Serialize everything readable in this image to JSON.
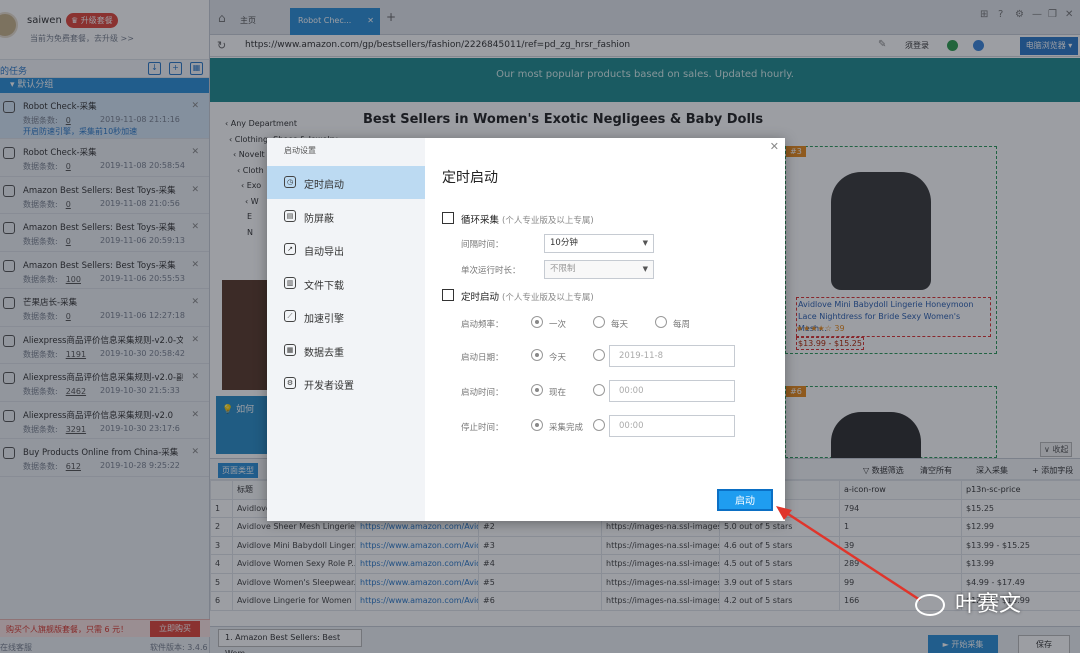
{
  "user": {
    "name": "saiwen",
    "upgrade_badge": "♛ 升级套餐",
    "free_hint": "当前为免费套餐，去升级 >>"
  },
  "task_toolbar": {
    "label": "的任务"
  },
  "group": {
    "name": "默认分组"
  },
  "tasks": [
    {
      "title": "Robot Check-采集",
      "count_label": "数据条数:",
      "count": "0",
      "time": "2019-11-08 21:1:16",
      "alert": "开启防速引擎，采集前10秒加速"
    },
    {
      "title": "Robot Check-采集",
      "count_label": "数据条数:",
      "count": "0",
      "time": "2019-11-08 20:58:54"
    },
    {
      "title": "Amazon Best Sellers: Best Toys-采集",
      "count_label": "数据条数:",
      "count": "0",
      "time": "2019-11-08 21:0:56"
    },
    {
      "title": "Amazon Best Sellers: Best Toys-采集",
      "count_label": "数据条数:",
      "count": "0",
      "time": "2019-11-06 20:59:13"
    },
    {
      "title": "Amazon Best Sellers: Best Toys-采集",
      "count_label": "数据条数:",
      "count": "100",
      "time": "2019-11-06 20:55:53"
    },
    {
      "title": "芒果店长-采集",
      "count_label": "数据条数:",
      "count": "0",
      "time": "2019-11-06 12:27:18"
    },
    {
      "title": "Aliexpress商品评价信息采集规则-v2.0-文章...",
      "count_label": "数据条数:",
      "count": "1191",
      "time": "2019-10-30 20:58:42"
    },
    {
      "title": "Aliexpress商品评价信息采集规则-v2.0-副本",
      "count_label": "数据条数:",
      "count": "2462",
      "time": "2019-10-30 21:5:33"
    },
    {
      "title": "Aliexpress商品评价信息采集规则-v2.0",
      "count_label": "数据条数:",
      "count": "3291",
      "time": "2019-10-30 23:17:6"
    },
    {
      "title": "Buy Products Online from China-采集",
      "count_label": "数据条数:",
      "count": "612",
      "time": "2019-10-28 9:25:22"
    }
  ],
  "promo": {
    "text": "购买个人旗舰版套餐，只需 6 元！",
    "button": "立即购买"
  },
  "sidebar_footer": {
    "left": "在线客服",
    "right": "软件版本: 3.4.6"
  },
  "browser": {
    "home_tab": "主页",
    "active_tab": "Robot Chec...",
    "url": "https://www.amazon.com/gp/bestsellers/fashion/2226845011/ref=pd_zg_hrsr_fashion",
    "login": "须登录",
    "mode_button": "电脑浏览器 ▾"
  },
  "page": {
    "banner": "Our most popular products based on sales. Updated hourly.",
    "title": "Best Sellers in Women's Exotic Negligees & Baby Dolls",
    "departments": [
      "‹ Any Department",
      "‹ Clothing, Shoes & Jewelry",
      "‹ Novelt",
      "‹ Cloth",
      "‹ Exo",
      "‹ W",
      "E",
      "N"
    ],
    "product": {
      "rank": "#3",
      "name": "Avidlove Mini Babydoll Lingerie Honeymoon Lace Nightdress for Bride Sexy Women's Mesh...",
      "rating": "★★★★☆ 39",
      "price": "$13.99 - $15.25"
    },
    "product2_rank": "#6",
    "ad_text": "如何",
    "collapse": "∨ 收起"
  },
  "data_panel": {
    "page_type_tab": "页面类型",
    "actions": [
      "▽ 数据筛选",
      "清空所有",
      "深入采集",
      "+ 添加字段"
    ],
    "columns": [
      "",
      "标题",
      "",
      "",
      "",
      "",
      "a-icon-row",
      "p13n-sc-price"
    ],
    "rows": [
      [
        "1",
        "Avidlove",
        "",
        "",
        "",
        "",
        "794",
        "$15.25"
      ],
      [
        "2",
        "Avidlove Sheer Mesh Lingerie...",
        "https://www.amazon.com/Avid...",
        "#2",
        "https://images-na.ssl-images-...",
        "5.0 out of 5 stars",
        "1",
        "$12.99"
      ],
      [
        "3",
        "Avidlove Mini Babydoll Linger...",
        "https://www.amazon.com/Avid...",
        "#3",
        "https://images-na.ssl-images-...",
        "4.6 out of 5 stars",
        "39",
        "$13.99 - $15.25"
      ],
      [
        "4",
        "Avidlove Women Sexy Role P...",
        "https://www.amazon.com/Avid...",
        "#4",
        "https://images-na.ssl-images-...",
        "4.5 out of 5 stars",
        "289",
        "$13.99"
      ],
      [
        "5",
        "Avidlove Women's Sleepwear...",
        "https://www.amazon.com/Avid...",
        "#5",
        "https://images-na.ssl-images-...",
        "3.9 out of 5 stars",
        "99",
        "$4.99 - $17.49"
      ],
      [
        "6",
        "Avidlove Lingerie for Women ...",
        "https://www.amazon.com/Avid...",
        "#6",
        "https://images-na.ssl-images-...",
        "4.2 out of 5 stars",
        "166",
        "$12.99 - $13.99"
      ]
    ],
    "bottom_tab": "1. Amazon Best Sellers: Best Wom...",
    "start_collect": "► 开始采集",
    "save": "保存"
  },
  "dialog": {
    "header_label": "启动设置",
    "nav": [
      {
        "label": "定时启动",
        "icon": "clock-icon"
      },
      {
        "label": "防屏蔽",
        "icon": "shield-icon"
      },
      {
        "label": "自动导出",
        "icon": "export-icon"
      },
      {
        "label": "文件下载",
        "icon": "file-icon"
      },
      {
        "label": "加速引擎",
        "icon": "speed-icon"
      },
      {
        "label": "数据去重",
        "icon": "dedupe-icon"
      },
      {
        "label": "开发者设置",
        "icon": "gear-icon"
      }
    ],
    "title": "定时启动",
    "loop": {
      "label": "循环采集",
      "note": "(个人专业版及以上专属)",
      "interval_label": "间隔时间：",
      "interval_value": "10分钟",
      "max_run_label": "单次运行时长：",
      "max_run_value": "不限制"
    },
    "schedule": {
      "label": "定时启动",
      "note": "(个人专业版及以上专属)",
      "freq_label": "启动频率：",
      "freq_options": [
        "一次",
        "每天",
        "每周"
      ],
      "date_label": "启动日期：",
      "date_today": "今天",
      "date_value": "2019-11-8",
      "time_label": "启动时间：",
      "time_now": "现在",
      "time_value": "00:00",
      "stop_label": "停止时间：",
      "stop_done": "采集完成",
      "stop_value": "00:00"
    },
    "start_button": "启动"
  },
  "watermark": "叶赛文"
}
